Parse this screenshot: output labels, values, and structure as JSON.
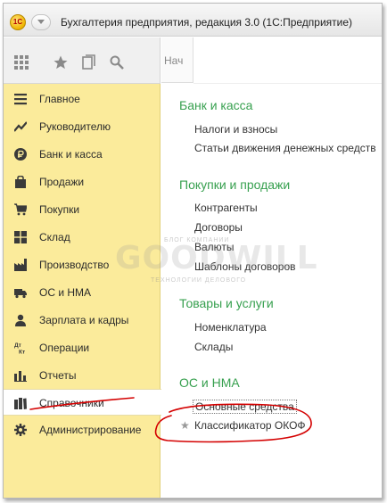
{
  "window": {
    "title": "Бухгалтерия предприятия, редакция 3.0  (1С:Предприятие)",
    "logo_text": "1С"
  },
  "toolbar": {
    "icons": [
      "apps-grid-icon",
      "star-icon",
      "history-icon",
      "search-icon"
    ],
    "tab_stub_label": "Нач"
  },
  "sidebar": {
    "items": [
      {
        "label": "Главное",
        "icon": "menu-lines-icon",
        "active": false
      },
      {
        "label": "Руководителю",
        "icon": "trend-line-icon",
        "active": false
      },
      {
        "label": "Банк и касса",
        "icon": "ruble-coin-icon",
        "active": false
      },
      {
        "label": "Продажи",
        "icon": "shopping-bag-icon",
        "active": false
      },
      {
        "label": "Покупки",
        "icon": "shopping-cart-icon",
        "active": false
      },
      {
        "label": "Склад",
        "icon": "warehouse-grid-icon",
        "active": false
      },
      {
        "label": "Производство",
        "icon": "factory-icon",
        "active": false
      },
      {
        "label": "ОС и НМА",
        "icon": "truck-icon",
        "active": false
      },
      {
        "label": "Зарплата и кадры",
        "icon": "person-icon",
        "active": false
      },
      {
        "label": "Операции",
        "icon": "dt-kt-icon",
        "active": false
      },
      {
        "label": "Отчеты",
        "icon": "bar-chart-icon",
        "active": false
      },
      {
        "label": "Справочники",
        "icon": "books-icon",
        "active": true
      },
      {
        "label": "Администрирование",
        "icon": "gear-icon",
        "active": false
      }
    ]
  },
  "panel": {
    "sections": [
      {
        "title": "Банк и касса",
        "items": [
          "Налоги и взносы",
          "Статьи движения денежных средств"
        ]
      },
      {
        "title": "Покупки и продажи",
        "items": [
          "Контрагенты",
          "Договоры",
          "Валюты",
          "Шаблоны договоров"
        ]
      },
      {
        "title": "Товары и услуги",
        "items": [
          "Номенклатура",
          "Склады"
        ]
      },
      {
        "title": "ОС и НМА",
        "items": [
          "Основные средства",
          "Классификатор ОКОФ"
        ]
      }
    ]
  },
  "watermark": {
    "brand": "GOODWILL",
    "top_line": "БЛОГ КОМПАНИИ",
    "bottom_line": "ТЕХНОЛОГИИ ДЕЛОВОГО"
  },
  "colors": {
    "sidebar_bg": "#fbeb9b",
    "section_title": "#37a04f",
    "annotation_red": "#d40000"
  }
}
